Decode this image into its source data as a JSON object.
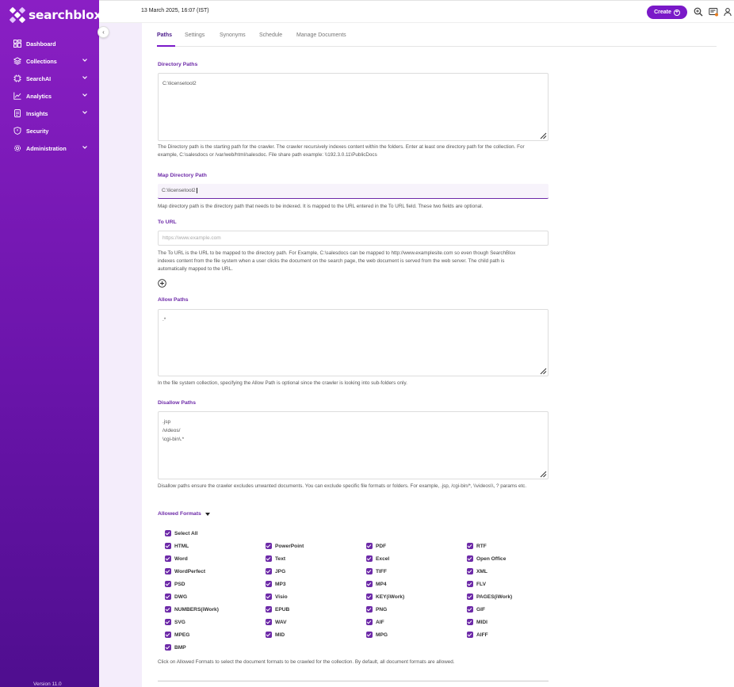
{
  "brand": {
    "name": "searchblox"
  },
  "sidebar": {
    "items": [
      {
        "label": "Dashboard",
        "icon": "dashboard-icon",
        "has_submenu": false
      },
      {
        "label": "Collections",
        "icon": "layers-icon",
        "has_submenu": true
      },
      {
        "label": "SearchAI",
        "icon": "ai-chip-icon",
        "has_submenu": true
      },
      {
        "label": "Analytics",
        "icon": "line-chart-icon",
        "has_submenu": true
      },
      {
        "label": "Insights",
        "icon": "document-icon",
        "has_submenu": true
      },
      {
        "label": "Security",
        "icon": "shield-icon",
        "has_submenu": false
      },
      {
        "label": "Administration",
        "icon": "gear-icon",
        "has_submenu": true
      }
    ],
    "version": "Version 11.0"
  },
  "header": {
    "datetime": "13 March 2025, 16:07 (IST)",
    "create_label": "Create",
    "icons": [
      "search-zoom-icon",
      "notifications-icon",
      "user-icon"
    ]
  },
  "tabs": [
    {
      "label": "Paths",
      "active": true
    },
    {
      "label": "Settings",
      "active": false
    },
    {
      "label": "Synonyms",
      "active": false
    },
    {
      "label": "Schedule",
      "active": false
    },
    {
      "label": "Manage Documents",
      "active": false
    }
  ],
  "form": {
    "directory_paths": {
      "label": "Directory Paths",
      "value": "C:\\licensetool2",
      "help": "The Directory path is the starting path for the crawler. The crawler recursively indexes content within the folders. Enter at least one directory path for the collection. For example, C:\\salesdocs or /var/web/html/salesdoc. File share path example: \\\\192.3.0.11\\PublicDocs"
    },
    "map_directory_path": {
      "label": "Map Directory Path",
      "value": "C:\\licensetool2",
      "help": "Map directory path is the directory path that needs to be indexed. It is mapped to the URL entered in the To URL field. These two fields are optional."
    },
    "to_url": {
      "label": "To URL",
      "placeholder": "https://www.example.com",
      "help": "The To URL is the URL to be mapped to the directory path. For Example, C:\\salesdocs can be mapped to http://www.examplesite.com so even though SearchBlox indexes content from the file system when a user clicks the document on the search page, the web document is served from the web server. The child path is automatically mapped to the URL."
    },
    "allow_paths": {
      "label": "Allow Paths",
      "value": ".*",
      "help": "In the file system collection, specifying the Allow Path is optional since the crawler is looking into sub-folders only."
    },
    "disallow_paths": {
      "label": "Disallow Paths",
      "lines": [
        ".jsp",
        "/videos/",
        "\\cgi-bin\\.*"
      ],
      "help": "Disallow paths ensure the crawler excludes unwanted documents. You can exclude specific file formats or folders. For example, .jsp, /cgi-bin/*, \\\\videos\\\\, ? params etc."
    },
    "allowed_formats": {
      "label": "Allowed Formats",
      "select_all": "Select All",
      "formats": [
        "HTML",
        "PowerPoint",
        "PDF",
        "RTF",
        "Word",
        "Text",
        "Excel",
        "Open Office",
        "WordPerfect",
        "JPG",
        "TIFF",
        "XML",
        "PSD",
        "MP3",
        "MP4",
        "FLV",
        "DWG",
        "Visio",
        "KEY(iWork)",
        "PAGES(iWork)",
        "NUMBERS(iWork)",
        "EPUB",
        "PNG",
        "GIF",
        "SVG",
        "WAV",
        "AIF",
        "MIDI",
        "MPEG",
        "MID",
        "MPG",
        "AIFF",
        "BMP"
      ],
      "help": "Click on Allowed Formats to select the document formats to be crawled for the collection. By default, all document formats are allowed."
    }
  },
  "colors": {
    "brand_purple": "#7a19c8",
    "label_purple": "#6d2aa8",
    "checkbox": "#6d2aa8"
  }
}
